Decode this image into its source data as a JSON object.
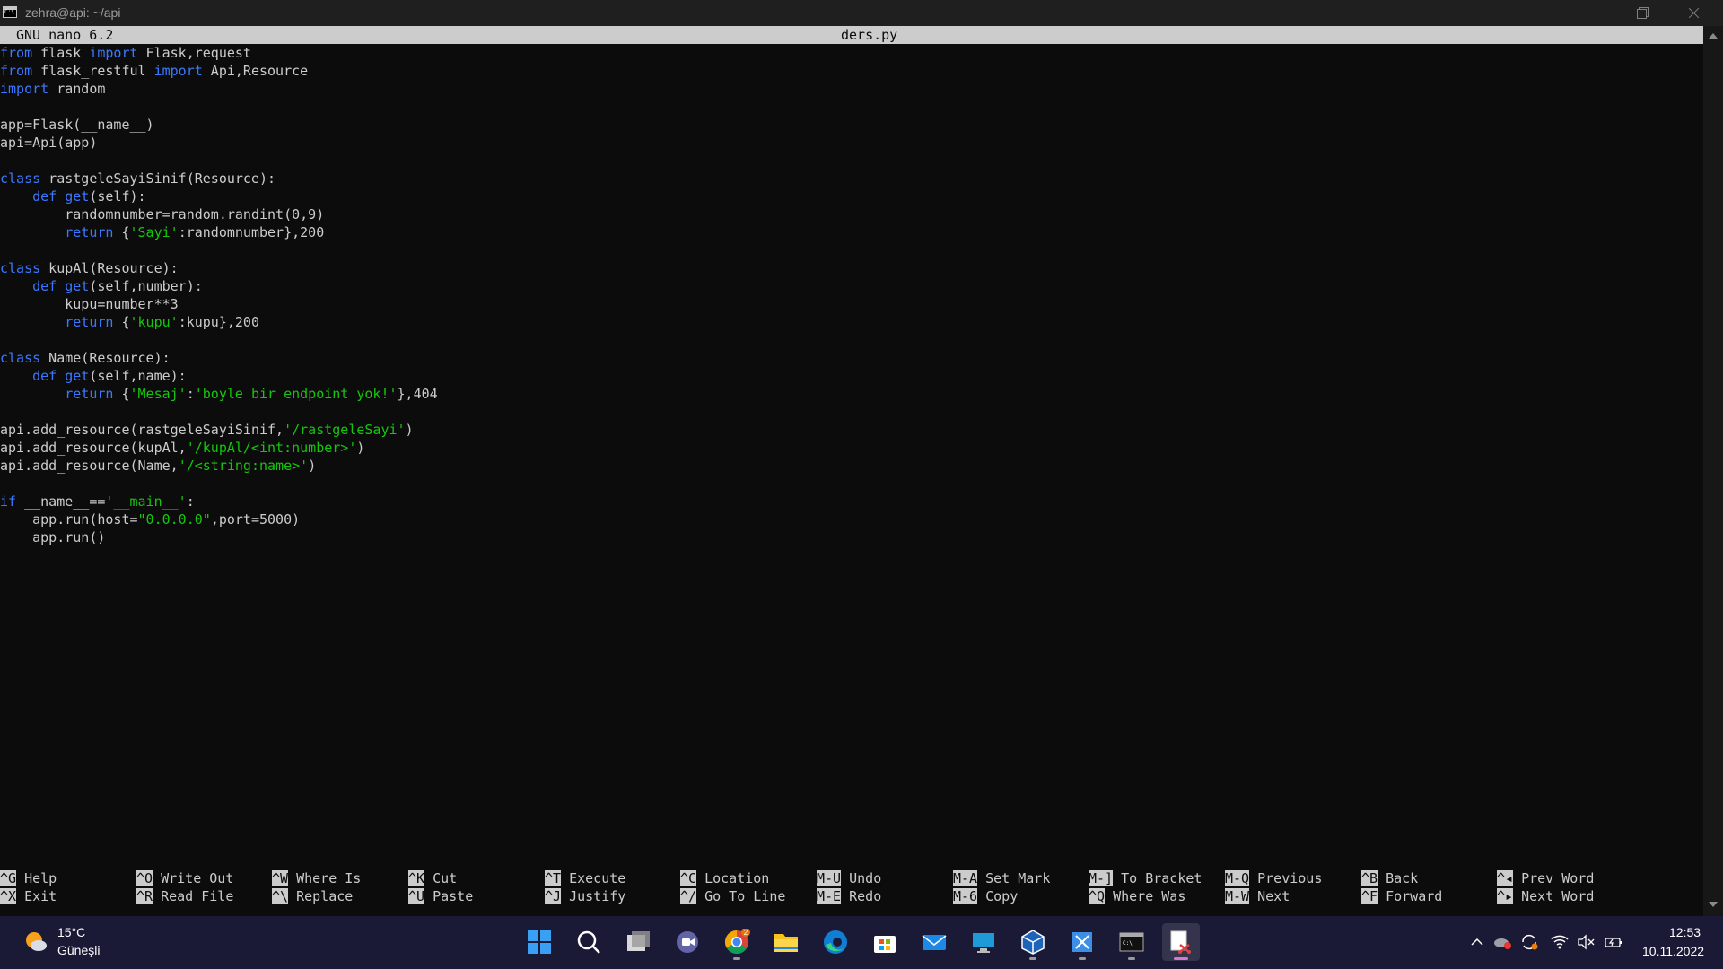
{
  "window": {
    "title": "zehra@api: ~/api"
  },
  "nano": {
    "version": "GNU nano 6.2",
    "filename": "ders.py",
    "code_lines": [
      [
        {
          "t": "from",
          "c": "kw"
        },
        {
          "t": " flask "
        },
        {
          "t": "import",
          "c": "kw"
        },
        {
          "t": " Flask,request"
        }
      ],
      [
        {
          "t": "from",
          "c": "kw"
        },
        {
          "t": " flask_restful "
        },
        {
          "t": "import",
          "c": "kw"
        },
        {
          "t": " Api,Resource"
        }
      ],
      [
        {
          "t": "import",
          "c": "kw"
        },
        {
          "t": " random"
        }
      ],
      [],
      [
        {
          "t": "app=Flask(__name__)"
        }
      ],
      [
        {
          "t": "api=Api(app)"
        }
      ],
      [],
      [
        {
          "t": "class",
          "c": "kw"
        },
        {
          "t": " rastgeleSayiSinif(Resource):"
        }
      ],
      [
        {
          "t": "    "
        },
        {
          "t": "def",
          "c": "kw"
        },
        {
          "t": " "
        },
        {
          "t": "get",
          "c": "fn"
        },
        {
          "t": "(self):"
        }
      ],
      [
        {
          "t": "        randomnumber=random.randint(0,9)"
        }
      ],
      [
        {
          "t": "        "
        },
        {
          "t": "return",
          "c": "kw"
        },
        {
          "t": " {"
        },
        {
          "t": "'Sayi'",
          "c": "str"
        },
        {
          "t": ":randomnumber},200"
        }
      ],
      [],
      [
        {
          "t": "class",
          "c": "kw"
        },
        {
          "t": " kupAl(Resource):"
        }
      ],
      [
        {
          "t": "    "
        },
        {
          "t": "def",
          "c": "kw"
        },
        {
          "t": " "
        },
        {
          "t": "get",
          "c": "fn"
        },
        {
          "t": "(self,number):"
        }
      ],
      [
        {
          "t": "        kupu=number**3"
        }
      ],
      [
        {
          "t": "        "
        },
        {
          "t": "return",
          "c": "kw"
        },
        {
          "t": " {"
        },
        {
          "t": "'kupu'",
          "c": "str"
        },
        {
          "t": ":kupu},200"
        }
      ],
      [],
      [
        {
          "t": "class",
          "c": "kw"
        },
        {
          "t": " Name(Resource):"
        }
      ],
      [
        {
          "t": "    "
        },
        {
          "t": "def",
          "c": "kw"
        },
        {
          "t": " "
        },
        {
          "t": "get",
          "c": "fn"
        },
        {
          "t": "(self,name):"
        }
      ],
      [
        {
          "t": "        "
        },
        {
          "t": "return",
          "c": "kw"
        },
        {
          "t": " {"
        },
        {
          "t": "'Mesaj'",
          "c": "str"
        },
        {
          "t": ":"
        },
        {
          "t": "'boyle bir endpoint yok!'",
          "c": "str"
        },
        {
          "t": "},404"
        }
      ],
      [],
      [
        {
          "t": "api.add_resource(rastgeleSayiSinif,"
        },
        {
          "t": "'/rastgeleSayi'",
          "c": "str"
        },
        {
          "t": ")"
        }
      ],
      [
        {
          "t": "api.add_resource(kupAl,"
        },
        {
          "t": "'/kupAl/<int:number>'",
          "c": "str"
        },
        {
          "t": ")"
        }
      ],
      [
        {
          "t": "api.add_resource(Name,"
        },
        {
          "t": "'/<string:name>'",
          "c": "str"
        },
        {
          "t": ")"
        }
      ],
      [],
      [
        {
          "t": "if",
          "c": "kw"
        },
        {
          "t": " __name__=="
        },
        {
          "t": "'__main__'",
          "c": "str"
        },
        {
          "t": ":"
        }
      ],
      [
        {
          "t": "    app.run(host="
        },
        {
          "t": "\"0.0.0.0\"",
          "c": "str"
        },
        {
          "t": ",port=5000)"
        }
      ],
      [
        {
          "t": "    app.run()"
        }
      ]
    ]
  },
  "shortcuts": [
    {
      "key": "^G",
      "label": "Help"
    },
    {
      "key": "^X",
      "label": "Exit"
    },
    {
      "key": "^O",
      "label": "Write Out"
    },
    {
      "key": "^R",
      "label": "Read File"
    },
    {
      "key": "^W",
      "label": "Where Is"
    },
    {
      "key": "^\\",
      "label": "Replace"
    },
    {
      "key": "^K",
      "label": "Cut"
    },
    {
      "key": "^U",
      "label": "Paste"
    },
    {
      "key": "^T",
      "label": "Execute"
    },
    {
      "key": "^J",
      "label": "Justify"
    },
    {
      "key": "^C",
      "label": "Location"
    },
    {
      "key": "^/",
      "label": "Go To Line"
    },
    {
      "key": "M-U",
      "label": "Undo"
    },
    {
      "key": "M-E",
      "label": "Redo"
    },
    {
      "key": "M-A",
      "label": "Set Mark"
    },
    {
      "key": "M-6",
      "label": "Copy"
    },
    {
      "key": "M-]",
      "label": "To Bracket"
    },
    {
      "key": "^Q",
      "label": "Where Was"
    },
    {
      "key": "M-Q",
      "label": "Previous"
    },
    {
      "key": "M-W",
      "label": "Next"
    },
    {
      "key": "^B",
      "label": "Back"
    },
    {
      "key": "^F",
      "label": "Forward"
    },
    {
      "key": "^◂",
      "label": "Prev Word"
    },
    {
      "key": "^▸",
      "label": "Next Word"
    }
  ],
  "taskbar": {
    "weather_temp": "15°C",
    "weather_desc": "Güneşli",
    "chrome_badge": "2",
    "clock_time": "12:53",
    "clock_date": "10.11.2022",
    "icons": [
      "windows-start-icon",
      "search-icon",
      "task-view-icon",
      "teams-chat-icon",
      "chrome-icon",
      "file-explorer-icon",
      "edge-icon",
      "microsoft-store-icon",
      "mail-icon",
      "remote-desktop-icon",
      "virtualbox-icon",
      "snipping-tool-icon",
      "terminal-icon",
      "terminal-active-icon"
    ],
    "tray_icons": [
      "chevron-up-icon",
      "onedrive-icon",
      "sync-icon",
      "wifi-icon",
      "speaker-muted-icon",
      "battery-icon"
    ]
  },
  "colors": {
    "keyword": "#3b78ff",
    "string": "#16c60c",
    "text": "#cccccc",
    "background": "#0c0c0c",
    "taskbar": "#1b1a36"
  }
}
